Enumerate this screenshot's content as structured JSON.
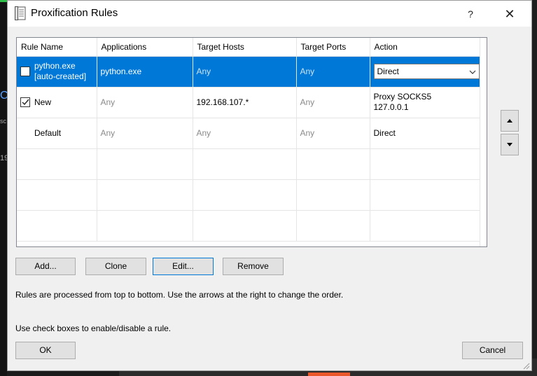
{
  "window": {
    "title": "Proxification Rules",
    "help_label": "?",
    "close_label": "✕"
  },
  "table": {
    "columns": [
      "Rule Name",
      "Applications",
      "Target Hosts",
      "Target Ports",
      "Action"
    ],
    "rows": [
      {
        "checked": false,
        "has_checkbox": true,
        "name_line1": "python.exe",
        "name_line2": "[auto-created]",
        "applications": "python.exe",
        "target_hosts": "Any",
        "target_ports": "Any",
        "action_line1": "Direct",
        "action_line2": "",
        "selected": true
      },
      {
        "checked": true,
        "has_checkbox": true,
        "name_line1": "New",
        "name_line2": "",
        "applications": "Any",
        "target_hosts": "192.168.107.*",
        "target_ports": "Any",
        "action_line1": "Proxy SOCKS5",
        "action_line2": "127.0.0.1",
        "selected": false
      },
      {
        "checked": false,
        "has_checkbox": false,
        "name_line1": "Default",
        "name_line2": "",
        "applications": "Any",
        "target_hosts": "Any",
        "target_ports": "Any",
        "action_line1": "Direct",
        "action_line2": "",
        "selected": false
      }
    ]
  },
  "buttons": {
    "add": "Add...",
    "clone": "Clone",
    "edit": "Edit...",
    "remove": "Remove",
    "ok": "OK",
    "cancel": "Cancel"
  },
  "info": {
    "line1": "Rules are processed from top to bottom. Use the arrows at the right to change the order.",
    "line2": "Use check boxes to enable/disable a rule."
  },
  "background": {
    "char1": "Co",
    "char2": "sc",
    "char3": "19"
  },
  "colors": {
    "selection": "#0078d7",
    "dialog_bg": "#f0f0f0",
    "button_bg": "#e1e1e1"
  }
}
